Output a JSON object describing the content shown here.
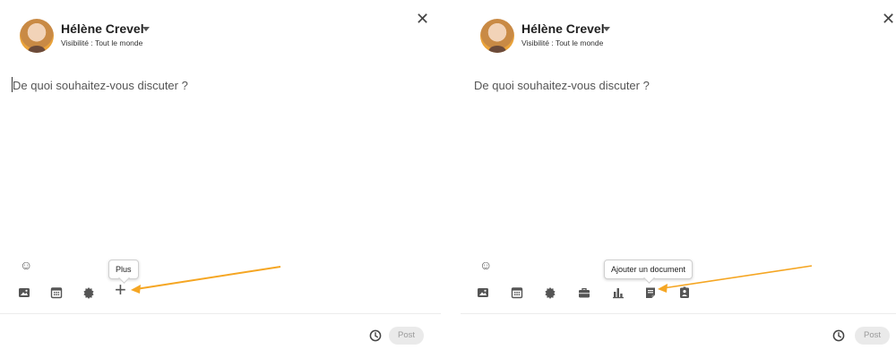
{
  "left_panel": {
    "user": {
      "name": "Hélène Crevel",
      "visibility": "Visibilité : Tout le monde"
    },
    "close_glyph": "✕",
    "composer": {
      "placeholder": "De quoi souhaitez-vous discuter ?"
    },
    "emoji_glyph": "☺",
    "toolbar": [
      {
        "icon": "image-icon"
      },
      {
        "icon": "calendar-icon"
      },
      {
        "icon": "celebrate-icon"
      }
    ],
    "more": {
      "glyph": "+",
      "tooltip": "Plus"
    },
    "schedule_icon": "clock-icon",
    "post_label": "Post"
  },
  "right_panel": {
    "user": {
      "name": "Hélène Crevel",
      "visibility": "Visibilité : Tout le monde"
    },
    "close_glyph": "✕",
    "composer": {
      "placeholder": "De quoi souhaitez-vous discuter ?"
    },
    "emoji_glyph": "☺",
    "toolbar": [
      {
        "icon": "image-icon"
      },
      {
        "icon": "calendar-icon"
      },
      {
        "icon": "celebrate-icon"
      },
      {
        "icon": "briefcase-icon"
      },
      {
        "icon": "poll-icon"
      },
      {
        "icon": "document-icon",
        "tooltip": "Ajouter un document"
      },
      {
        "icon": "badge-icon"
      }
    ],
    "schedule_icon": "clock-icon",
    "post_label": "Post"
  },
  "colors": {
    "annotation_arrow": "#f5a623",
    "icon": "#555555",
    "post_disabled_bg": "#eaeaea"
  }
}
